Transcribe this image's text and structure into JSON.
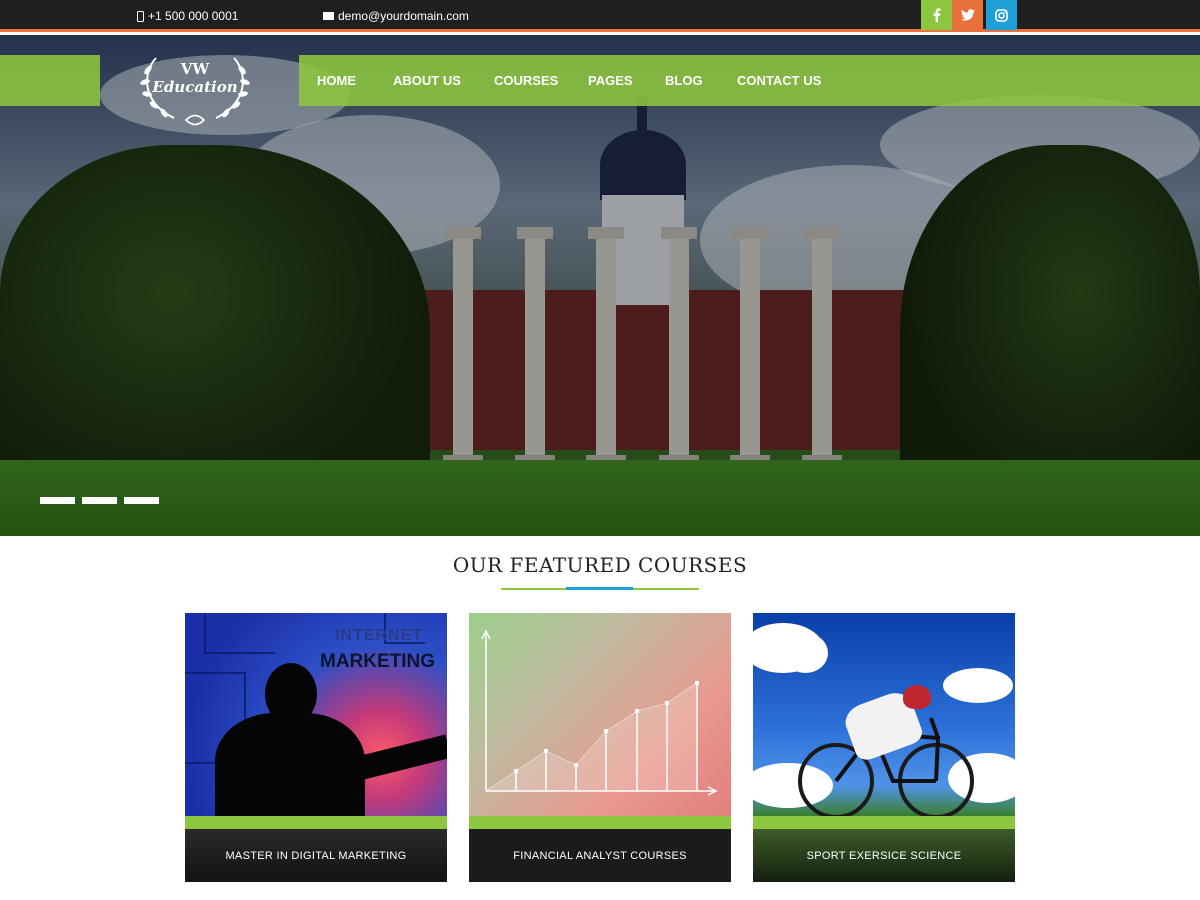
{
  "topbar": {
    "phone": "+1 500 000 0001",
    "email": "demo@yourdomain.com",
    "social": [
      "f",
      "twitter-icon",
      "instagram-icon"
    ]
  },
  "logo": {
    "line1": "VW",
    "line2": "Education"
  },
  "nav": {
    "items": [
      "HOME",
      "ABOUT US",
      "COURSES",
      "PAGES",
      "BLOG",
      "CONTACT US"
    ]
  },
  "slider": {
    "dots": 3
  },
  "featured": {
    "title": "OUR FEATURED COURSES",
    "courses": [
      {
        "caption": "MASTER IN DIGITAL MARKETING",
        "image_text_1": "INTERNET",
        "image_text_2": "MARKETING"
      },
      {
        "caption": "FINANCIAL ANALYST COURSES"
      },
      {
        "caption": "SPORT EXERSICE SCIENCE"
      }
    ]
  },
  "colors": {
    "accent_green": "#8dc63f",
    "accent_orange": "#e8703a",
    "accent_blue": "#1e9fd8",
    "topbar_bg": "#1f1f1f"
  }
}
